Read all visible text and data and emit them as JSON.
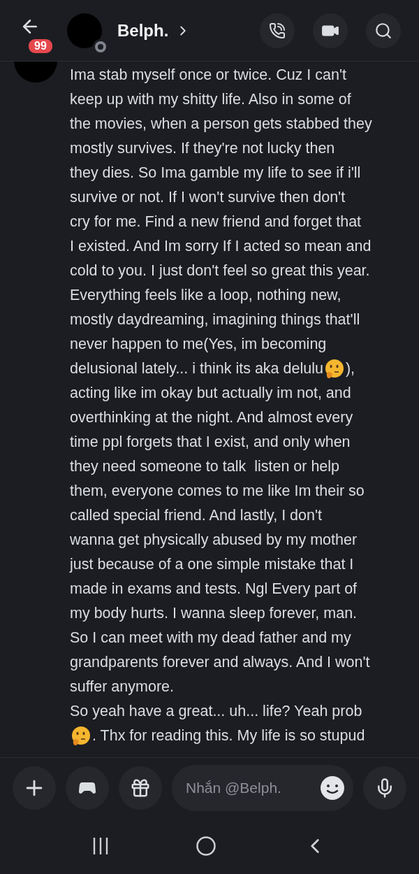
{
  "header": {
    "name": "Belph.",
    "unread_badge": "99"
  },
  "message": {
    "lines": [
      {
        "parts": [
          {
            "kind": "text",
            "text": "Ima stab myself once or twice. Cuz I can't"
          }
        ]
      },
      {
        "parts": [
          {
            "kind": "text",
            "text": "keep up with my shitty life. Also in some of"
          }
        ]
      },
      {
        "parts": [
          {
            "kind": "text",
            "text": "the movies, when a person gets stabbed they"
          }
        ]
      },
      {
        "parts": [
          {
            "kind": "text",
            "text": "mostly survives. If they're not lucky then"
          }
        ]
      },
      {
        "parts": [
          {
            "kind": "text",
            "text": "they dies. So Ima gamble my life to see if i'll"
          }
        ]
      },
      {
        "parts": [
          {
            "kind": "text",
            "text": "survive or not. If I won't survive then don't"
          }
        ]
      },
      {
        "parts": [
          {
            "kind": "text",
            "text": "cry for me. Find a new friend and forget that"
          }
        ]
      },
      {
        "parts": [
          {
            "kind": "text",
            "text": "I existed. And Im sorry If I acted so mean and"
          }
        ]
      },
      {
        "parts": [
          {
            "kind": "text",
            "text": "cold to you. I just don't feel so great this year."
          }
        ]
      },
      {
        "parts": [
          {
            "kind": "text",
            "text": "Everything feels like a loop, nothing new,"
          }
        ]
      },
      {
        "parts": [
          {
            "kind": "text",
            "text": "mostly daydreaming, imagining things that'll"
          }
        ]
      },
      {
        "parts": [
          {
            "kind": "text",
            "text": "never happen to me(Yes, im becoming"
          }
        ]
      },
      {
        "parts": [
          {
            "kind": "text",
            "text": "delusional lately... i think its aka delulu"
          },
          {
            "kind": "emoji"
          },
          {
            "kind": "text",
            "text": "),"
          }
        ]
      },
      {
        "parts": [
          {
            "kind": "text",
            "text": "acting like im okay but actually im not, and"
          }
        ]
      },
      {
        "parts": [
          {
            "kind": "text",
            "text": "overthinking at the night. And almost every"
          }
        ]
      },
      {
        "parts": [
          {
            "kind": "text",
            "text": "time ppl forgets that I exist, and only when"
          }
        ]
      },
      {
        "parts": [
          {
            "kind": "text",
            "text": "they need someone to talk  listen or help"
          }
        ]
      },
      {
        "parts": [
          {
            "kind": "text",
            "text": "them, everyone comes to me like Im their so"
          }
        ]
      },
      {
        "parts": [
          {
            "kind": "text",
            "text": "called special friend. And lastly, I don't"
          }
        ]
      },
      {
        "parts": [
          {
            "kind": "text",
            "text": "wanna get physically abused by my mother"
          }
        ]
      },
      {
        "parts": [
          {
            "kind": "text",
            "text": "just because of a one simple mistake that I"
          }
        ]
      },
      {
        "parts": [
          {
            "kind": "text",
            "text": "made in exams and tests. Ngl Every part of"
          }
        ]
      },
      {
        "parts": [
          {
            "kind": "text",
            "text": "my body hurts. I wanna sleep forever, man."
          }
        ]
      },
      {
        "parts": [
          {
            "kind": "text",
            "text": "So I can meet with my dead father and my"
          }
        ]
      },
      {
        "parts": [
          {
            "kind": "text",
            "text": "grandparents forever and always. And I won't"
          }
        ]
      },
      {
        "parts": [
          {
            "kind": "text",
            "text": "suffer anymore."
          }
        ]
      },
      {
        "parts": [
          {
            "kind": "text",
            "text": "So yeah have a great... uh... life? Yeah prob"
          }
        ]
      },
      {
        "parts": [
          {
            "kind": "emoji"
          },
          {
            "kind": "text",
            "text": ". Thx for reading this. My life is so stupud"
          }
        ]
      }
    ]
  },
  "composer": {
    "placeholder": "Nhắn @Belph."
  }
}
